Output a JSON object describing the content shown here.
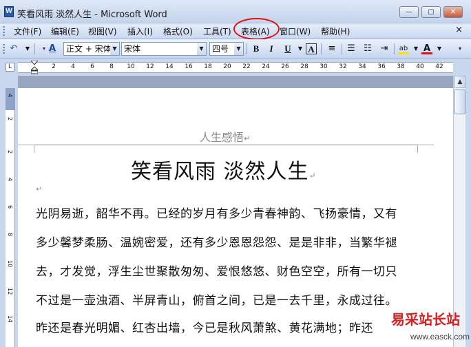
{
  "window": {
    "title": "笑看风雨 淡然人生 - Microsoft Word",
    "icon_name": "word-app-icon",
    "minimize_label": "—",
    "restore_label": "▢",
    "close_label": "✕"
  },
  "menubar": {
    "items": [
      {
        "label": "文件(F)"
      },
      {
        "label": "编辑(E)"
      },
      {
        "label": "视图(V)"
      },
      {
        "label": "插入(I)"
      },
      {
        "label": "格式(O)"
      },
      {
        "label": "工具(T)"
      },
      {
        "label": "表格(A)",
        "highlighted": true
      },
      {
        "label": "窗口(W)"
      },
      {
        "label": "帮助(H)"
      }
    ],
    "close_doc_label": "×",
    "highlight_color": "#e01010"
  },
  "toolbar": {
    "style_value": "正文 + 宋体",
    "font_value": "宋体",
    "size_value": "四号",
    "bold": "B",
    "italic": "I",
    "underline": "U",
    "char_border": "A",
    "font_color_glyph": "A",
    "highlight_glyph": "ab",
    "style_icon_text": "A"
  },
  "ruler": {
    "numbers": [
      "2",
      "4",
      "6",
      "8",
      "10",
      "12",
      "14",
      "16",
      "18",
      "20",
      "22",
      "24",
      "26",
      "28",
      "30",
      "32",
      "34",
      "36",
      "38",
      "40",
      "42"
    ],
    "corner_label": "L"
  },
  "vertical_ruler": {
    "numbers": [
      "4",
      "2",
      "2",
      "4",
      "6",
      "8",
      "10",
      "12",
      "14"
    ]
  },
  "document": {
    "header": "人生感悟",
    "title": "笑看风雨  淡然人生",
    "paragraph_mark": "↵",
    "lines": [
      "光阴易逝，韶华不再。已经的岁月有多少青春神韵、飞扬豪情，又有",
      "多少馨梦柔肠、温婉密爱，还有多少恩恩怨怨、是是非非，当繁华褪",
      "去，才发觉，浮生尘世聚散匆匆、爱恨悠悠、财色空空，所有一切只",
      "不过是一壶浊酒、半屏青山，俯首之间，已是一去千里，永成过往。",
      "昨还是春光明媚、红杏出墙，今已是秋风萧煞、黄花满地；昨还"
    ]
  },
  "watermark": {
    "text_cn": "易采站长站",
    "url": "www.easck.com"
  }
}
